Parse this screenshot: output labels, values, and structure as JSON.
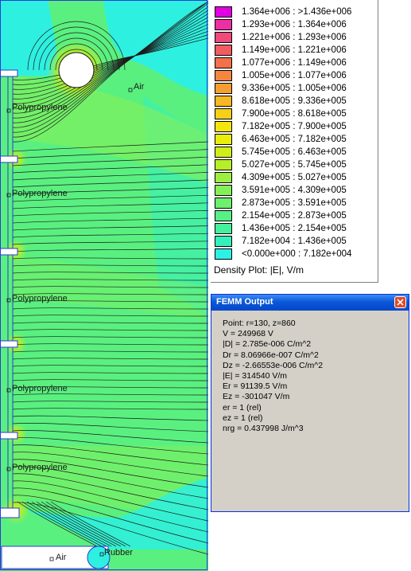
{
  "plot": {
    "region_labels": {
      "air_top": "Air",
      "poly_1": "Polypropylene",
      "poly_2": "Polypropylene",
      "poly_3": "Polypropylene",
      "poly_4": "Polypropylene",
      "poly_5": "Polypropylene",
      "air_bottom": "Air",
      "rubber": "Rubber"
    },
    "colors": {
      "cyan": "#2ef0e0",
      "green": "#5af080",
      "lime": "#a0ef48",
      "yellow": "#e8e80a",
      "contour": "#1a1a1a",
      "boundary": "#2b3bd6"
    }
  },
  "legend": {
    "title": "Density Plot: |E|, V/m",
    "entries": [
      {
        "label": "1.364e+006 : >1.436e+006",
        "color": "#e000e0"
      },
      {
        "label": "1.293e+006 : 1.364e+006",
        "color": "#ee2fa4"
      },
      {
        "label": "1.221e+006 : 1.293e+006",
        "color": "#ee4a7c"
      },
      {
        "label": "1.149e+006 : 1.221e+006",
        "color": "#f05c60"
      },
      {
        "label": "1.077e+006 : 1.149e+006",
        "color": "#f2704c"
      },
      {
        "label": "1.005e+006 : 1.077e+006",
        "color": "#f48640"
      },
      {
        "label": "9.336e+005 : 1.005e+006",
        "color": "#f59e32"
      },
      {
        "label": "8.618e+005 : 9.336e+005",
        "color": "#f7b824"
      },
      {
        "label": "7.900e+005 : 8.618e+005",
        "color": "#f6d018"
      },
      {
        "label": "7.182e+005 : 7.900e+005",
        "color": "#f4e60c"
      },
      {
        "label": "6.463e+005 : 7.182e+005",
        "color": "#e8ee08"
      },
      {
        "label": "5.745e+005 : 6.463e+005",
        "color": "#d0ee18"
      },
      {
        "label": "5.027e+005 : 5.745e+005",
        "color": "#b6ee2a"
      },
      {
        "label": "4.309e+005 : 5.027e+005",
        "color": "#9cef40"
      },
      {
        "label": "3.591e+005 : 4.309e+005",
        "color": "#84f058"
      },
      {
        "label": "2.873e+005 : 3.591e+005",
        "color": "#6cf06e"
      },
      {
        "label": "2.154e+005 : 2.873e+005",
        "color": "#56f084"
      },
      {
        "label": "1.436e+005 : 2.154e+005",
        "color": "#44f09c"
      },
      {
        "label": "7.182e+004 : 1.436e+005",
        "color": "#36f0bc"
      },
      {
        "label": "<0.000e+000 : 7.182e+004",
        "color": "#2cf2e6"
      }
    ]
  },
  "output_window": {
    "title": "FEMM Output",
    "lines": [
      "Point: r=130, z=860",
      "V   = 249968 V",
      "|D| = 2.785e-006 C/m^2",
      "Dr  = 8.06966e-007 C/m^2",
      "Dz  = -2.66553e-006 C/m^2",
      "|E| = 314540 V/m",
      "Er  = 91139.5 V/m",
      "Ez  = -301047 V/m",
      "er  = 1 (rel)",
      "ez  = 1 (rel)",
      "nrg = 0.437998 J/m^3"
    ]
  }
}
